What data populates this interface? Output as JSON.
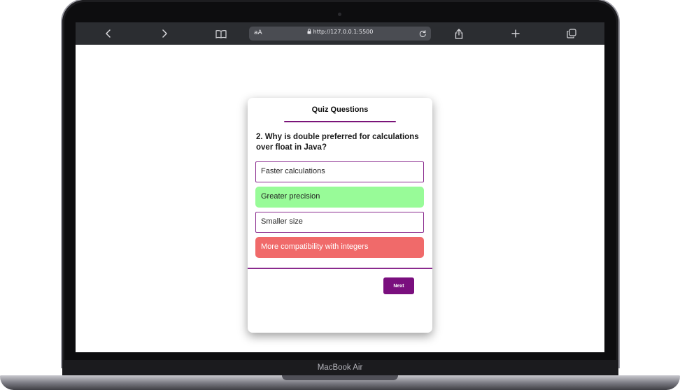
{
  "device": {
    "brand_label": "MacBook Air"
  },
  "browser": {
    "text_size_label": "aA",
    "url": "http://127.0.0.1:5500",
    "icons": [
      "chevron-left-icon",
      "chevron-right-icon",
      "book-icon",
      "lock-icon",
      "reload-icon",
      "share-icon",
      "plus-icon",
      "tabs-icon"
    ]
  },
  "quiz": {
    "title": "Quiz Questions",
    "question": "2. Why is double preferred for calculations over float in Java?",
    "options": [
      {
        "label": "Faster calculations",
        "state": "default"
      },
      {
        "label": "Greater precision",
        "state": "correct"
      },
      {
        "label": "Smaller size",
        "state": "default"
      },
      {
        "label": "More compatibility with integers",
        "state": "wrong"
      }
    ],
    "next_label": "Next"
  },
  "colors": {
    "accent": "#7a0f7e",
    "option_border": "#8a2a8e",
    "correct": "#98fb98",
    "wrong": "#f06a6a"
  }
}
